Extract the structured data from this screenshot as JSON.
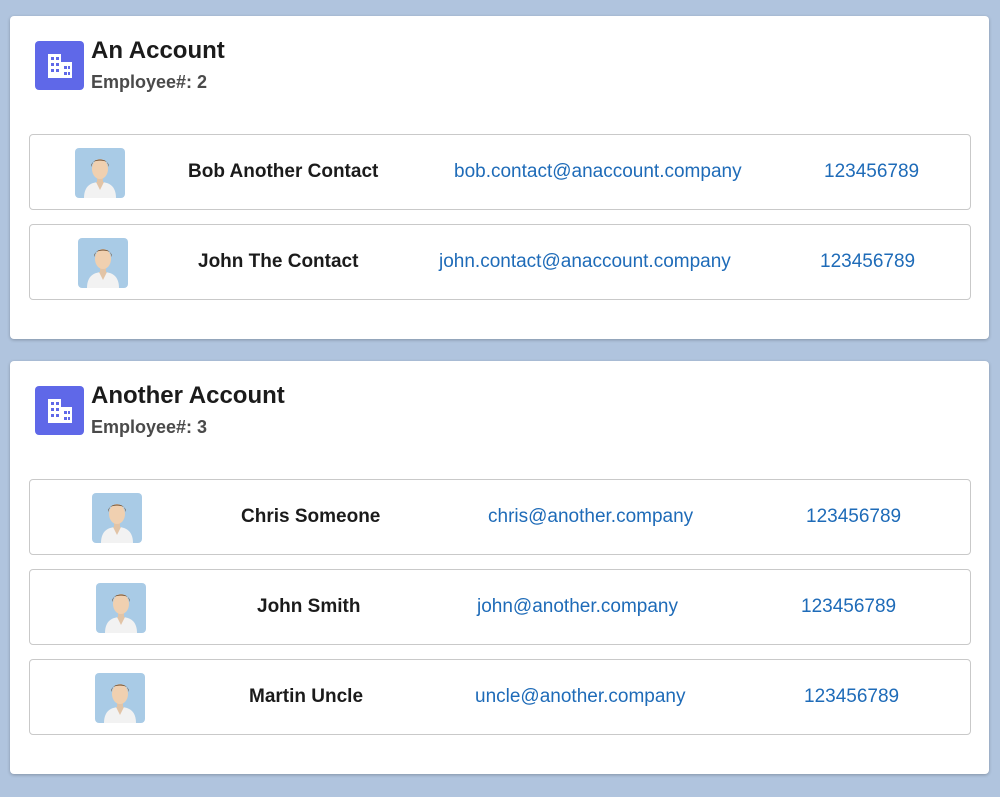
{
  "colors": {
    "icon_bg": "#5f68e8",
    "link": "#1e6bb8",
    "avatar_bg": "#a9cbe6"
  },
  "accounts": [
    {
      "name": "An Account",
      "employees": "Employee#: 2",
      "icon": "building-icon",
      "contacts": [
        {
          "name": "Bob Another Contact",
          "email": "bob.contact@anaccount.company",
          "phone": "123456789",
          "avatar": "person-avatar-icon"
        },
        {
          "name": "John The Contact",
          "email": "john.contact@anaccount.company",
          "phone": "123456789",
          "avatar": "person-avatar-icon"
        }
      ]
    },
    {
      "name": "Another Account",
      "employees": "Employee#: 3",
      "icon": "building-icon",
      "contacts": [
        {
          "name": "Chris Someone",
          "email": "chris@another.company",
          "phone": "123456789",
          "avatar": "person-avatar-icon"
        },
        {
          "name": "John Smith",
          "email": "john@another.company",
          "phone": "123456789",
          "avatar": "person-avatar-icon"
        },
        {
          "name": "Martin Uncle",
          "email": "uncle@another.company",
          "phone": "123456789",
          "avatar": "person-avatar-icon"
        }
      ]
    }
  ]
}
